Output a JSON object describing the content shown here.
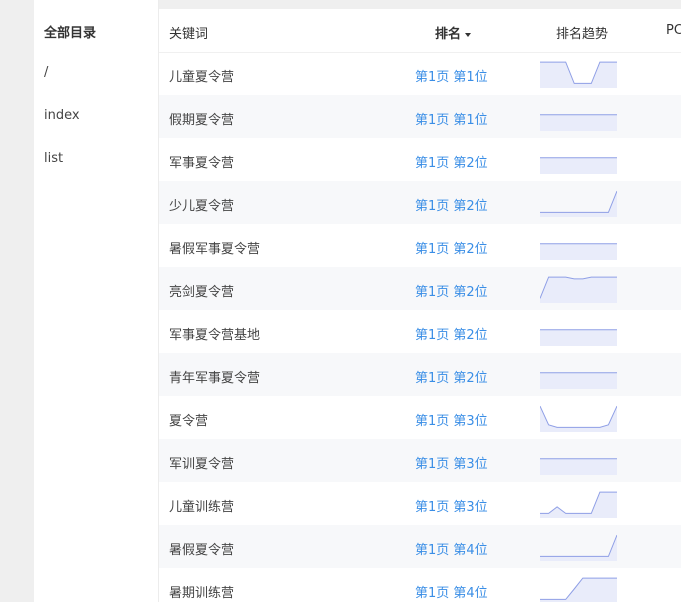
{
  "sidebar": {
    "title": "全部目录",
    "items": [
      {
        "label": "/"
      },
      {
        "label": "index"
      },
      {
        "label": "list"
      }
    ]
  },
  "table": {
    "headers": {
      "keyword": "关键词",
      "rank": "排名",
      "trend": "排名趋势",
      "pc": "PC"
    },
    "rows": [
      {
        "keyword": "儿童夏令营",
        "rank": "第1页 第1位",
        "trend": [
          0.92,
          0.92,
          0.92,
          0.92,
          0.1,
          0.1,
          0.1,
          0.92,
          0.92,
          0.92
        ]
      },
      {
        "keyword": "假期夏令营",
        "rank": "第1页 第1位",
        "trend": [
          0.55,
          0.55,
          0.55,
          0.55,
          0.55,
          0.55,
          0.55,
          0.55,
          0.55,
          0.55
        ]
      },
      {
        "keyword": "军事夏令营",
        "rank": "第1页 第2位",
        "trend": [
          0.55,
          0.55,
          0.55,
          0.55,
          0.55,
          0.55,
          0.55,
          0.55,
          0.55,
          0.55
        ]
      },
      {
        "keyword": "少儿夏令营",
        "rank": "第1页 第2位",
        "trend": [
          0.1,
          0.1,
          0.1,
          0.1,
          0.1,
          0.1,
          0.1,
          0.1,
          0.1,
          0.92
        ]
      },
      {
        "keyword": "暑假军事夏令营",
        "rank": "第1页 第2位",
        "trend": [
          0.55,
          0.55,
          0.55,
          0.55,
          0.55,
          0.55,
          0.55,
          0.55,
          0.55,
          0.55
        ]
      },
      {
        "keyword": "亮剑夏令营",
        "rank": "第1页 第2位",
        "trend": [
          0.1,
          0.92,
          0.92,
          0.92,
          0.85,
          0.85,
          0.92,
          0.92,
          0.92,
          0.92
        ]
      },
      {
        "keyword": "军事夏令营基地",
        "rank": "第1页 第2位",
        "trend": [
          0.55,
          0.55,
          0.55,
          0.55,
          0.55,
          0.55,
          0.55,
          0.55,
          0.55,
          0.55
        ]
      },
      {
        "keyword": "青年军事夏令营",
        "rank": "第1页 第2位",
        "trend": [
          0.55,
          0.55,
          0.55,
          0.55,
          0.55,
          0.55,
          0.55,
          0.55,
          0.55,
          0.55
        ]
      },
      {
        "keyword": "夏令营",
        "rank": "第1页 第3位",
        "trend": [
          0.92,
          0.2,
          0.1,
          0.1,
          0.1,
          0.1,
          0.1,
          0.1,
          0.2,
          0.92
        ]
      },
      {
        "keyword": "军训夏令营",
        "rank": "第1页 第3位",
        "trend": [
          0.55,
          0.55,
          0.55,
          0.55,
          0.55,
          0.55,
          0.55,
          0.55,
          0.55,
          0.55
        ]
      },
      {
        "keyword": "儿童训练营",
        "rank": "第1页 第3位",
        "trend": [
          0.1,
          0.1,
          0.35,
          0.1,
          0.1,
          0.1,
          0.1,
          0.92,
          0.92,
          0.92
        ]
      },
      {
        "keyword": "暑假夏令营",
        "rank": "第1页 第4位",
        "trend": [
          0.1,
          0.1,
          0.1,
          0.1,
          0.1,
          0.1,
          0.1,
          0.1,
          0.1,
          0.92
        ]
      },
      {
        "keyword": "暑期训练营",
        "rank": "第1页 第4位",
        "trend": [
          0.1,
          0.1,
          0.1,
          0.1,
          0.5,
          0.92,
          0.92,
          0.92,
          0.92,
          0.92
        ]
      }
    ]
  },
  "colors": {
    "link": "#3a8ee6",
    "spark_line": "#8f9fe6",
    "spark_fill": "#e9ecfa"
  }
}
